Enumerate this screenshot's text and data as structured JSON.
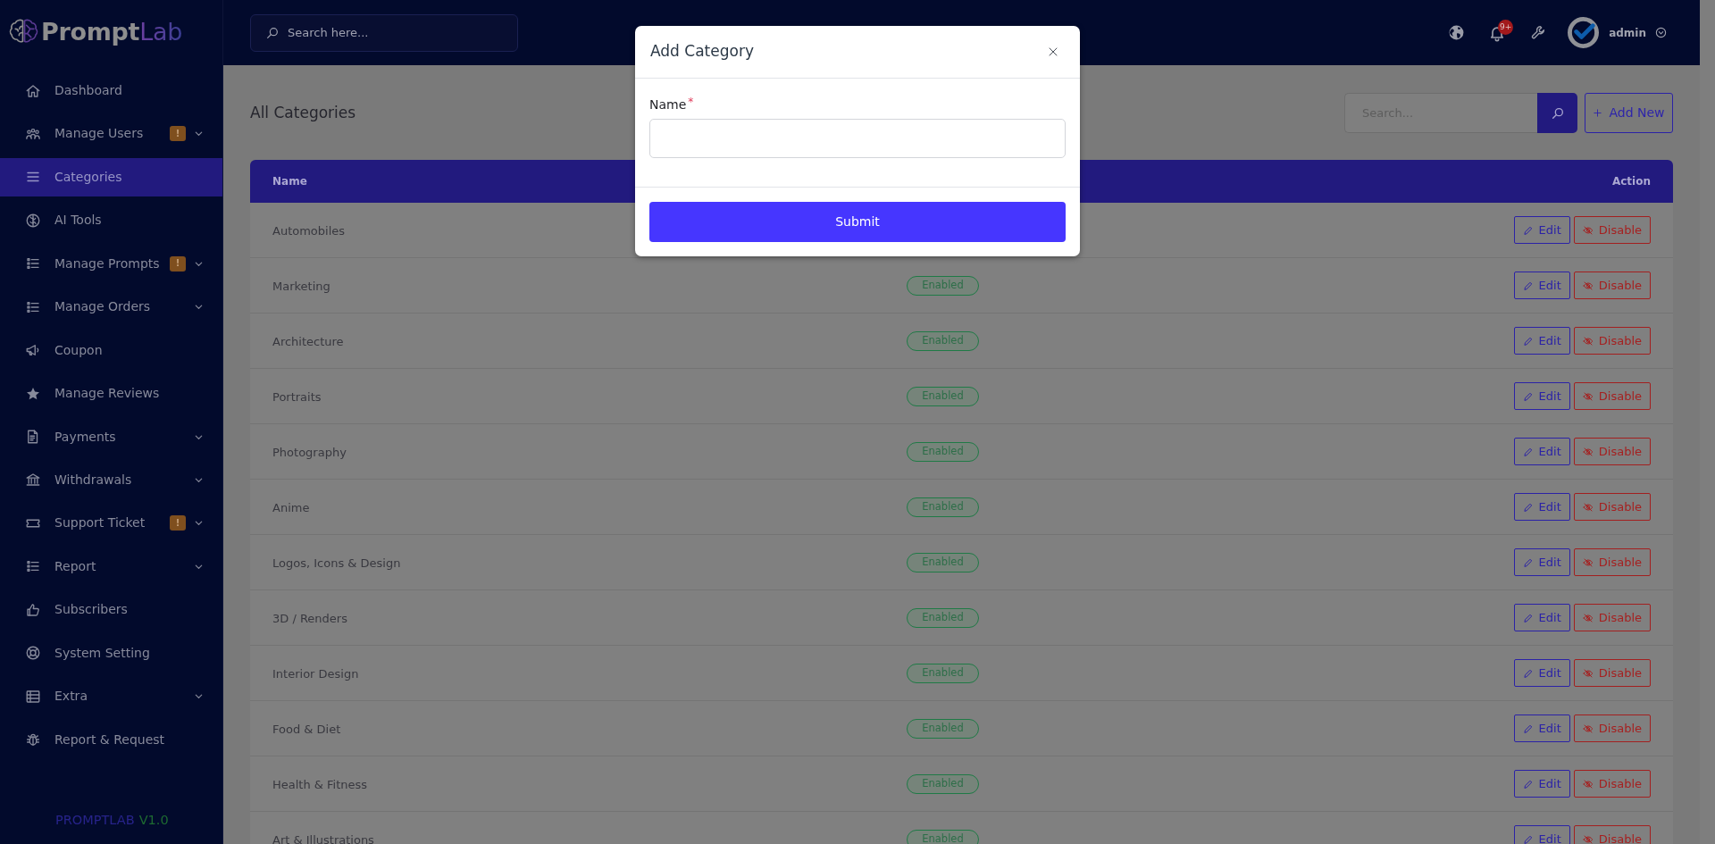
{
  "sidebar": {
    "logo": {
      "parts": [
        "Prompt",
        "Lab"
      ]
    },
    "items": [
      {
        "label": "Dashboard",
        "selected": false,
        "expandable": false
      },
      {
        "label": "Manage Users",
        "selected": false,
        "expandable": true,
        "badge": "!"
      },
      {
        "label": "Categories",
        "selected": true,
        "expandable": false
      },
      {
        "label": "AI Tools",
        "selected": false,
        "expandable": false
      },
      {
        "label": "Manage Prompts",
        "selected": false,
        "expandable": true,
        "badge": "!"
      },
      {
        "label": "Manage Orders",
        "selected": false,
        "expandable": true
      },
      {
        "label": "Coupon",
        "selected": false,
        "expandable": false
      },
      {
        "label": "Manage Reviews",
        "selected": false,
        "expandable": false
      },
      {
        "label": "Payments",
        "selected": false,
        "expandable": true
      },
      {
        "label": "Withdrawals",
        "selected": false,
        "expandable": true
      },
      {
        "label": "Support Ticket",
        "selected": false,
        "expandable": true,
        "badge": "!"
      },
      {
        "label": "Report",
        "selected": false,
        "expandable": true
      },
      {
        "label": "Subscribers",
        "selected": false,
        "expandable": false
      },
      {
        "label": "System Setting",
        "selected": false,
        "expandable": false
      },
      {
        "label": "Extra",
        "selected": false,
        "expandable": true
      },
      {
        "label": "Report & Request",
        "selected": false,
        "expandable": false
      }
    ],
    "footer": {
      "product": "PROMPTLAB",
      "version": "V1.0"
    }
  },
  "topbar": {
    "search": {
      "placeholder": "Search here..."
    },
    "notification_badge": "9+",
    "user": {
      "name": "admin"
    }
  },
  "page": {
    "title": "All Categories",
    "search": {
      "placeholder": "Search..."
    },
    "add_button": "Add New"
  },
  "table": {
    "columns": [
      "Name",
      "Action"
    ],
    "rows": [
      {
        "name": "Automobiles",
        "actions": [
          {
            "kind": "edit",
            "label": "Edit"
          },
          {
            "kind": "disable",
            "label": "Disable"
          }
        ]
      },
      {
        "name": "Marketing",
        "status": "Enabled",
        "actions": [
          {
            "kind": "edit",
            "label": "Edit"
          },
          {
            "kind": "disable",
            "label": "Disable"
          }
        ]
      },
      {
        "name": "Architecture",
        "status": "Enabled",
        "actions": [
          {
            "kind": "edit",
            "label": "Edit"
          },
          {
            "kind": "disable",
            "label": "Disable"
          }
        ]
      },
      {
        "name": "Portraits",
        "status": "Enabled",
        "actions": [
          {
            "kind": "edit",
            "label": "Edit"
          },
          {
            "kind": "disable",
            "label": "Disable"
          }
        ]
      },
      {
        "name": "Photography",
        "status": "Enabled",
        "actions": [
          {
            "kind": "edit",
            "label": "Edit"
          },
          {
            "kind": "disable",
            "label": "Disable"
          }
        ]
      },
      {
        "name": "Anime",
        "status": "Enabled",
        "actions": [
          {
            "kind": "edit",
            "label": "Edit"
          },
          {
            "kind": "disable",
            "label": "Disable"
          }
        ]
      },
      {
        "name": "Logos, Icons & Design",
        "status": "Enabled",
        "actions": [
          {
            "kind": "edit",
            "label": "Edit"
          },
          {
            "kind": "disable",
            "label": "Disable"
          }
        ]
      },
      {
        "name": "3D / Renders",
        "status": "Enabled",
        "actions": [
          {
            "kind": "edit",
            "label": "Edit"
          },
          {
            "kind": "disable",
            "label": "Disable"
          }
        ]
      },
      {
        "name": "Interior Design",
        "status": "Enabled",
        "actions": [
          {
            "kind": "edit",
            "label": "Edit"
          },
          {
            "kind": "disable",
            "label": "Disable"
          }
        ]
      },
      {
        "name": "Food & Diet",
        "status": "Enabled",
        "actions": [
          {
            "kind": "edit",
            "label": "Edit"
          },
          {
            "kind": "disable",
            "label": "Disable"
          }
        ]
      },
      {
        "name": "Health & Fitness",
        "status": "Enabled",
        "actions": [
          {
            "kind": "edit",
            "label": "Edit"
          },
          {
            "kind": "disable",
            "label": "Disable"
          }
        ]
      },
      {
        "name": "Art & Illustrations",
        "status": "Enabled",
        "actions": [
          {
            "kind": "edit",
            "label": "Edit"
          },
          {
            "kind": "disable",
            "label": "Disable"
          }
        ]
      }
    ]
  },
  "modal": {
    "title": "Add Category",
    "field": {
      "label": "Name",
      "required_mark": "*"
    },
    "submit": "Submit"
  }
}
